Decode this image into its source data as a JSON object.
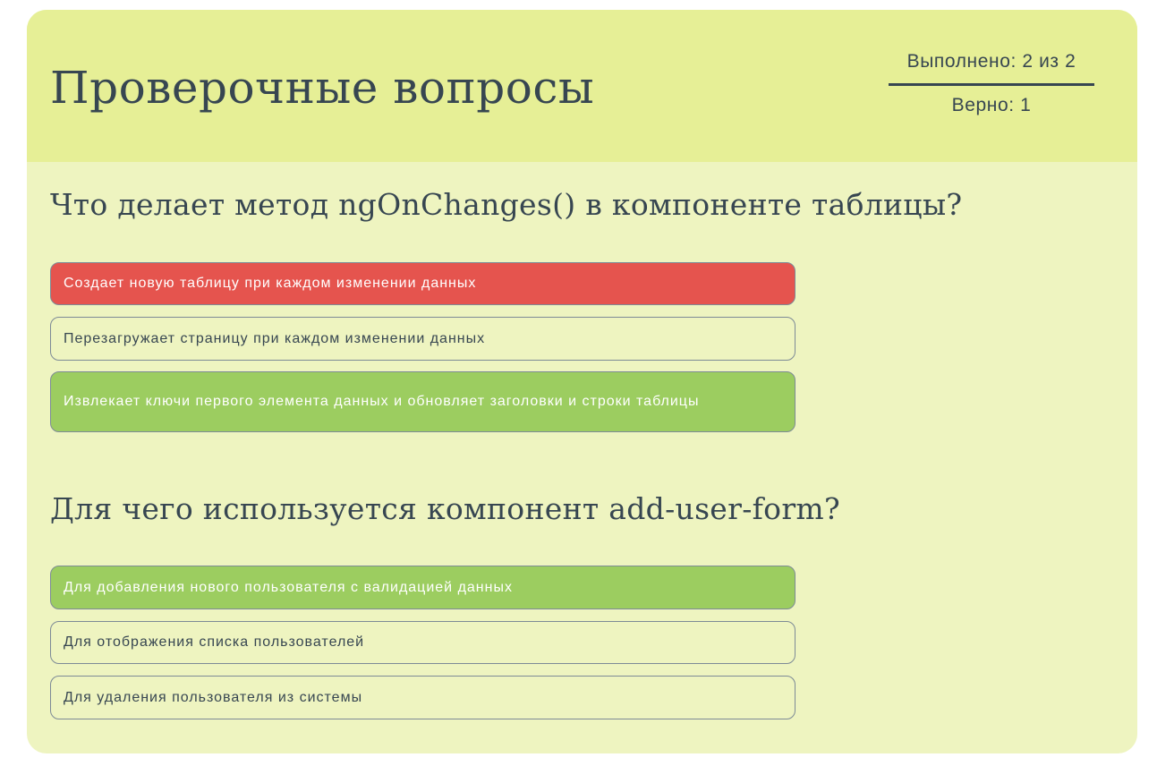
{
  "header": {
    "title": "Проверочные вопросы",
    "done_label": "Выполнено: 2 из 2",
    "correct_label": "Верно: 1"
  },
  "questions": [
    {
      "title": "Что делает метод ngOnChanges() в компоненте таблицы?",
      "answers": [
        {
          "label": "Создает новую таблицу при каждом изменении данных",
          "state": "wrong"
        },
        {
          "label": "Перезагружает страницу при каждом изменении данных",
          "state": "neutral"
        },
        {
          "label": "Извлекает ключи первого элемента данных и обновляет заголовки и строки таблицы",
          "state": "correct"
        }
      ]
    },
    {
      "title": "Для чего используется компонент add-user-form?",
      "answers": [
        {
          "label": "Для добавления нового пользователя с валидацией данных",
          "state": "correct"
        },
        {
          "label": "Для отображения списка пользователей",
          "state": "neutral"
        },
        {
          "label": "Для удаления пользователя из системы",
          "state": "neutral"
        }
      ]
    }
  ],
  "colors": {
    "header_bg": "#e6ef96",
    "card_bg": "#eef4c0",
    "text": "#374651",
    "wrong": "#e5544e",
    "correct": "#9ccd60"
  }
}
